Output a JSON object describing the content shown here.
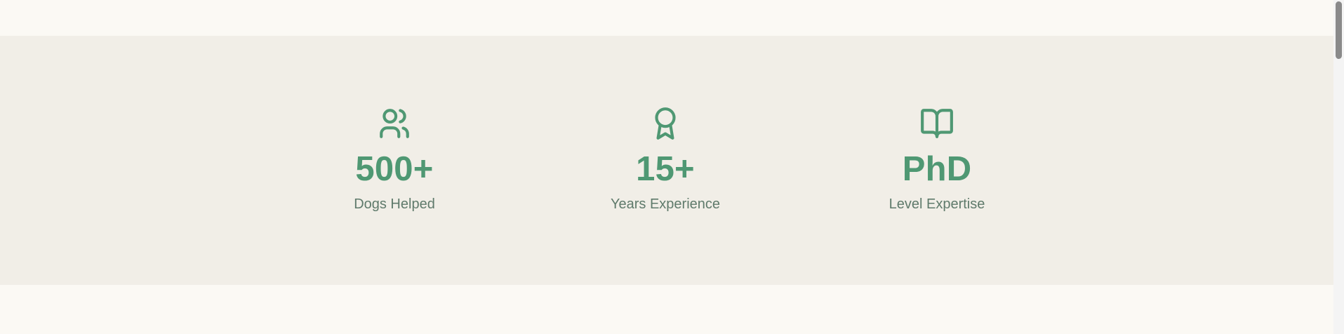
{
  "stats": [
    {
      "icon": "users-icon",
      "value": "500+",
      "label": "Dogs Helped"
    },
    {
      "icon": "award-icon",
      "value": "15+",
      "label": "Years Experience"
    },
    {
      "icon": "open-book-icon",
      "value": "PhD",
      "label": "Level Expertise"
    }
  ],
  "colors": {
    "accent": "#4f9873",
    "label": "#5f7a6b",
    "band_background": "#f1eee7",
    "page_background": "#fbf9f4"
  }
}
